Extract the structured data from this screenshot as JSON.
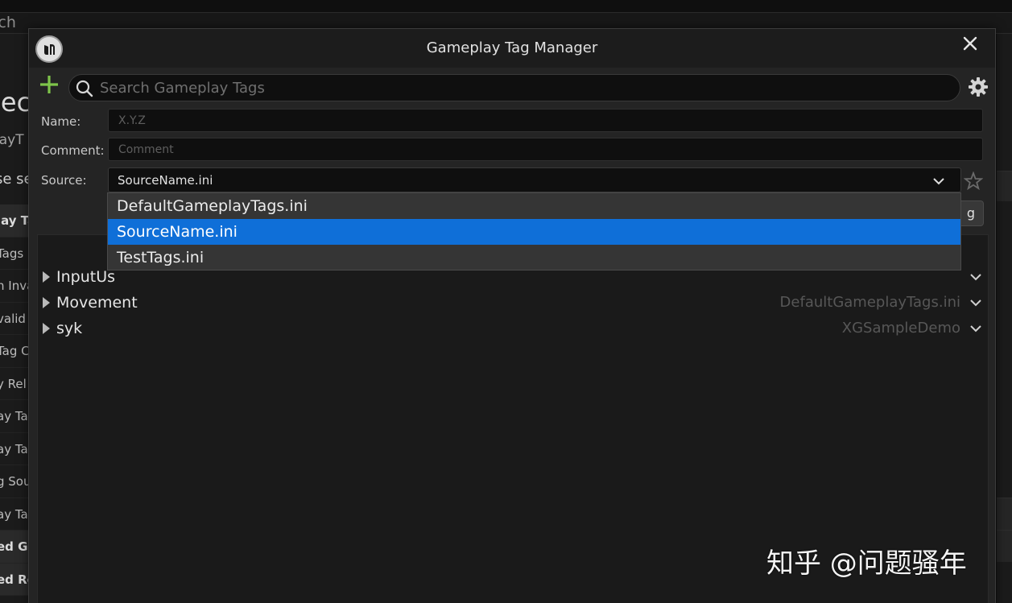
{
  "background": {
    "search_text": "rch",
    "title_fragment": "jec",
    "subtitle_fragment": "layT",
    "section_fragment": "se se",
    "rows": [
      {
        "text": "lay Ta",
        "style": "dark bold"
      },
      {
        "text": "Tags",
        "style": ""
      },
      {
        "text": "n Inva",
        "style": ""
      },
      {
        "text": "valid",
        "style": ""
      },
      {
        "text": "Tag C",
        "style": ""
      },
      {
        "text": "y Rel",
        "style": ""
      },
      {
        "text": "ay Ta",
        "style": ""
      },
      {
        "text": "ay Ta",
        "style": ""
      },
      {
        "text": "g Sou",
        "style": ""
      },
      {
        "text": "ay Ta",
        "style": ""
      },
      {
        "text": "ed Ga",
        "style": "dark bold"
      },
      {
        "text": "ed Re",
        "style": "dark bold"
      }
    ]
  },
  "dialog": {
    "title": "Gameplay Tag Manager",
    "search": {
      "placeholder": "Search Gameplay Tags",
      "value": ""
    },
    "form": {
      "name_label": "Name:",
      "name_placeholder": "X.Y.Z",
      "comment_label": "Comment:",
      "comment_placeholder": "Comment",
      "source_label": "Source:",
      "source_value": "SourceName.ini",
      "add_button_label": "g"
    },
    "source_options": [
      {
        "label": "DefaultGameplayTags.ini",
        "selected": false
      },
      {
        "label": "SourceName.ini",
        "selected": true
      },
      {
        "label": "TestTags.ini",
        "selected": false
      }
    ],
    "tree": [
      {
        "label": "InputUs",
        "source": ""
      },
      {
        "label": "Movement",
        "source": "DefaultGameplayTags.ini"
      },
      {
        "label": "syk",
        "source": "XGSampleDemo"
      }
    ]
  },
  "watermark": "知乎 @问题骚年",
  "colors": {
    "accent_add": "#7ec44a",
    "selection": "#0f6fd8",
    "panel": "#242424",
    "field": "#0f0f0f"
  },
  "icons": [
    "unreal-logo-icon",
    "close-icon",
    "plus-icon",
    "search-icon",
    "gear-icon",
    "chevron-down-icon",
    "star-icon",
    "expand-arrow-icon"
  ]
}
